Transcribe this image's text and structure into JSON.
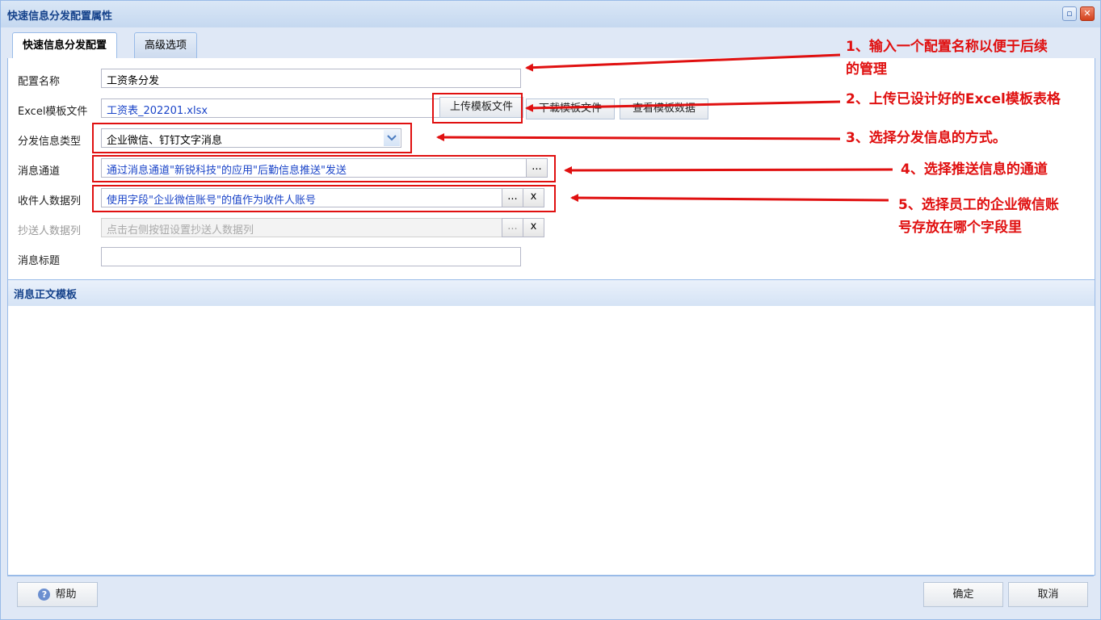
{
  "window": {
    "title": "快速信息分发配置属性",
    "restore_icon": "restore-icon",
    "close_icon": "close-icon"
  },
  "tabs": [
    {
      "label": "快速信息分发配置",
      "active": true
    },
    {
      "label": "高级选项",
      "active": false
    }
  ],
  "form": {
    "config_name": {
      "label": "配置名称",
      "value": "工资条分发"
    },
    "excel_template": {
      "label": "Excel模板文件",
      "value": "工资表_202201.xlsx",
      "upload_label": "上传模板文件",
      "download_label": "下载模板文件",
      "view_label": "查看模板数据"
    },
    "dist_type": {
      "label": "分发信息类型",
      "value": "企业微信、钉钉文字消息"
    },
    "channel": {
      "label": "消息通道",
      "value": "通过消息通道\"新锐科技\"的应用\"后勤信息推送\"发送",
      "picker": "..."
    },
    "recipient_col": {
      "label": "收件人数据列",
      "value": "使用字段\"企业微信账号\"的值作为收件人账号",
      "picker": "...",
      "clear": "x"
    },
    "cc_col": {
      "label": "抄送人数据列",
      "placeholder": "点击右侧按钮设置抄送人数据列",
      "picker": "...",
      "clear": "x"
    },
    "msg_title": {
      "label": "消息标题",
      "value": ""
    }
  },
  "section": {
    "title": "消息正文模板"
  },
  "footer": {
    "help_label": "帮助",
    "ok_label": "确定",
    "cancel_label": "取消"
  },
  "annotations": {
    "a1_line1": "1、输入一个配置名称以便于后续",
    "a1_line2": "的管理",
    "a2": "2、上传已设计好的Excel模板表格",
    "a3": "3、选择分发信息的方式。",
    "a4": "4、选择推送信息的通道",
    "a5_line1": "5、选择员工的企业微信账",
    "a5_line2": "号存放在哪个字段里",
    "color": "#e01010"
  }
}
